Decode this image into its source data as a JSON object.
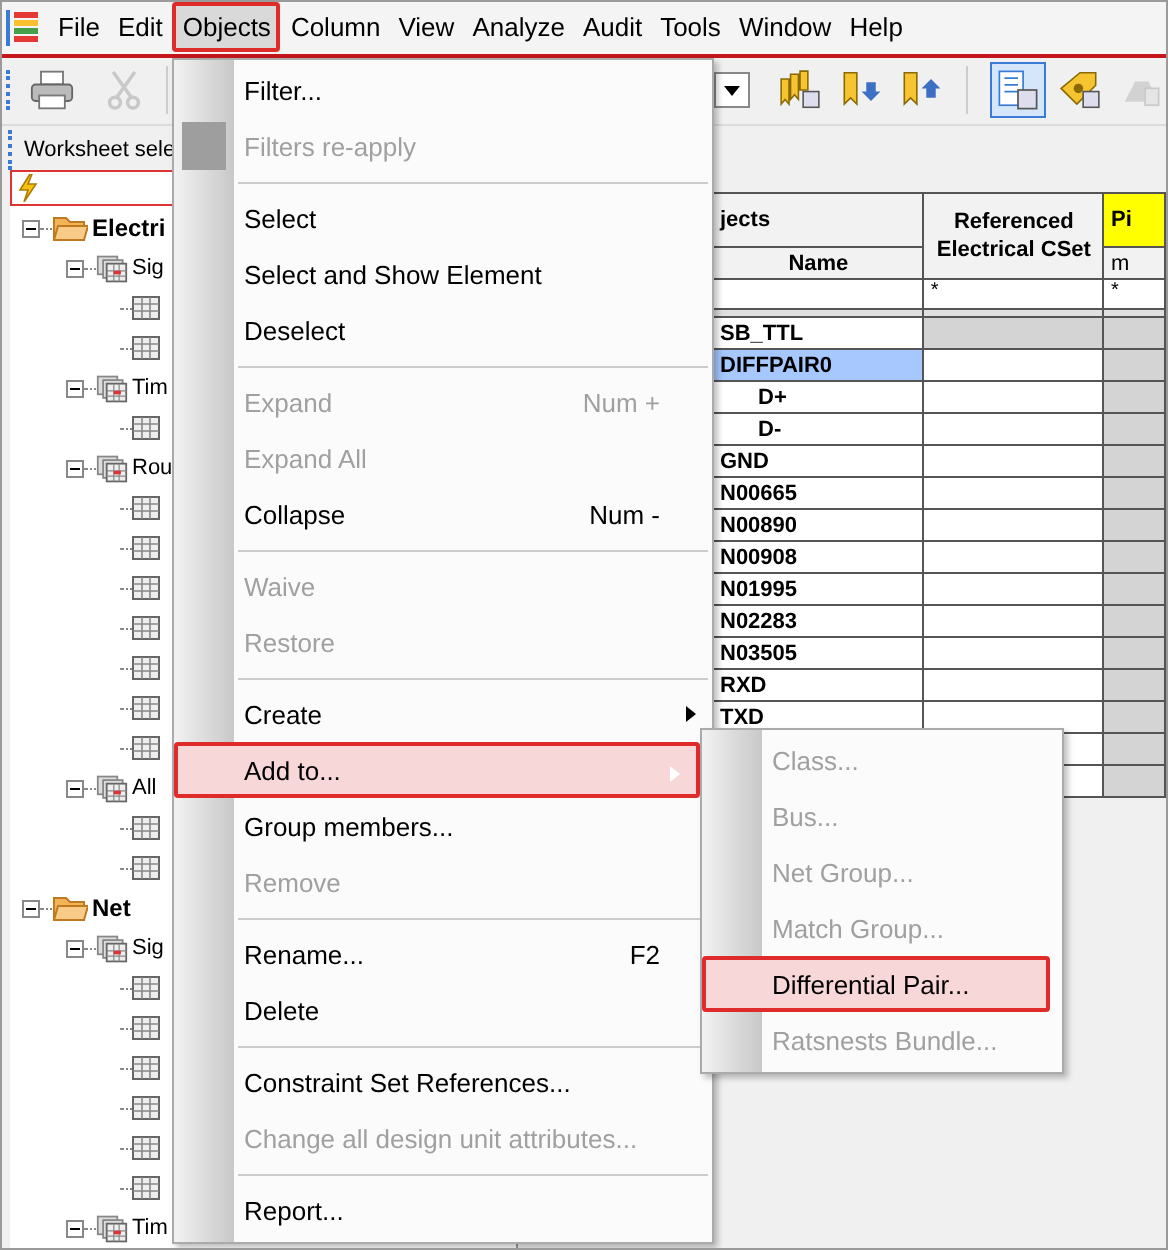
{
  "menubar": {
    "items": [
      {
        "label": "File",
        "selected": false
      },
      {
        "label": "Edit",
        "selected": false
      },
      {
        "label": "Objects",
        "selected": true
      },
      {
        "label": "Column",
        "selected": false
      },
      {
        "label": "View",
        "selected": false
      },
      {
        "label": "Analyze",
        "selected": false
      },
      {
        "label": "Audit",
        "selected": false
      },
      {
        "label": "Tools",
        "selected": false
      },
      {
        "label": "Window",
        "selected": false
      },
      {
        "label": "Help",
        "selected": false
      }
    ]
  },
  "toolbar": {
    "buttons": [
      {
        "kind": "printer",
        "disabled": false,
        "selected": false
      },
      {
        "kind": "scissors",
        "disabled": true,
        "selected": false
      },
      {
        "kind": "combo",
        "disabled": false,
        "selected": false
      },
      {
        "kind": "tags",
        "disabled": false,
        "selected": false
      },
      {
        "kind": "tag-down",
        "disabled": false,
        "selected": false
      },
      {
        "kind": "tag-up",
        "disabled": false,
        "selected": false
      },
      {
        "kind": "sheet",
        "disabled": false,
        "selected": true
      },
      {
        "kind": "tag-gear",
        "disabled": false,
        "selected": false
      },
      {
        "kind": "cloud",
        "disabled": true,
        "selected": false
      }
    ]
  },
  "worksheet_selector": {
    "title": "Worksheet sele"
  },
  "tree": [
    {
      "kind": "folder",
      "label": "Electri",
      "expanded": true,
      "children": [
        {
          "kind": "group",
          "label": "Sig",
          "expanded": true,
          "children": [
            {
              "kind": "table"
            },
            {
              "kind": "table"
            }
          ]
        },
        {
          "kind": "group",
          "label": "Tim",
          "expanded": true,
          "children": [
            {
              "kind": "table"
            }
          ]
        },
        {
          "kind": "group",
          "label": "Rou",
          "expanded": true,
          "children": [
            {
              "kind": "table"
            },
            {
              "kind": "table"
            },
            {
              "kind": "table"
            },
            {
              "kind": "table"
            },
            {
              "kind": "table"
            },
            {
              "kind": "table"
            },
            {
              "kind": "table"
            }
          ]
        },
        {
          "kind": "group",
          "label": "All",
          "expanded": true,
          "children": [
            {
              "kind": "table"
            },
            {
              "kind": "table"
            }
          ]
        }
      ]
    },
    {
      "kind": "folder",
      "label": "Net",
      "expanded": true,
      "children": [
        {
          "kind": "group",
          "label": "Sig",
          "expanded": true,
          "children": [
            {
              "kind": "table"
            },
            {
              "kind": "table"
            },
            {
              "kind": "table"
            },
            {
              "kind": "table"
            },
            {
              "kind": "table"
            },
            {
              "kind": "table"
            }
          ]
        },
        {
          "kind": "group",
          "label": "Tim",
          "expanded": true
        }
      ]
    }
  ],
  "table": {
    "group_header": "jects",
    "columns": [
      {
        "label": "Name"
      },
      {
        "label": "Referenced Electrical CSet",
        "filter": "*"
      },
      {
        "label": "Pi",
        "sub": "m",
        "filter": "*"
      }
    ],
    "rows": [
      {
        "name": "SB_TTL",
        "kind": "class",
        "selected": false
      },
      {
        "name": "DIFFPAIR0",
        "kind": "pair",
        "selected": true,
        "children": [
          {
            "name": "D+",
            "selected": false
          },
          {
            "name": "D-",
            "selected": false
          }
        ]
      },
      {
        "name": "GND",
        "kind": "net",
        "selected": false
      },
      {
        "name": "N00665",
        "kind": "net",
        "selected": false
      },
      {
        "name": "N00890",
        "kind": "net",
        "selected": false
      },
      {
        "name": "N00908",
        "kind": "net",
        "selected": false
      },
      {
        "name": "N01995",
        "kind": "net",
        "selected": false
      },
      {
        "name": "N02283",
        "kind": "net",
        "selected": false
      },
      {
        "name": "N03505",
        "kind": "net",
        "selected": false
      },
      {
        "name": "RXD",
        "kind": "net",
        "selected": false
      },
      {
        "name": "TXD",
        "kind": "net",
        "selected": false
      }
    ]
  },
  "objects_menu": {
    "items": [
      {
        "kind": "item",
        "label": "Filter...",
        "disabled": false,
        "selected": false
      },
      {
        "kind": "icon-item",
        "label": "Filters re-apply",
        "disabled": true,
        "selected": false
      },
      {
        "kind": "separator"
      },
      {
        "kind": "item",
        "label": "Select",
        "disabled": false,
        "selected": false
      },
      {
        "kind": "item",
        "label": "Select and Show Element",
        "disabled": false,
        "selected": false
      },
      {
        "kind": "item",
        "label": "Deselect",
        "disabled": false,
        "selected": false
      },
      {
        "kind": "separator"
      },
      {
        "kind": "item",
        "label": "Expand",
        "shortcut": "Num +",
        "disabled": true,
        "selected": false
      },
      {
        "kind": "item",
        "label": "Expand All",
        "disabled": true,
        "selected": false
      },
      {
        "kind": "item",
        "label": "Collapse",
        "shortcut": "Num -",
        "disabled": false,
        "selected": false
      },
      {
        "kind": "separator"
      },
      {
        "kind": "item",
        "label": "Waive",
        "disabled": true,
        "selected": false
      },
      {
        "kind": "item",
        "label": "Restore",
        "disabled": true,
        "selected": false
      },
      {
        "kind": "separator"
      },
      {
        "kind": "submenu",
        "label": "Create",
        "disabled": false,
        "selected": false
      },
      {
        "kind": "submenu",
        "label": "Add to...",
        "disabled": false,
        "selected": true
      },
      {
        "kind": "item",
        "label": "Group members...",
        "disabled": false,
        "selected": false
      },
      {
        "kind": "item",
        "label": "Remove",
        "disabled": true,
        "selected": false
      },
      {
        "kind": "separator"
      },
      {
        "kind": "item",
        "label": "Rename...",
        "shortcut": "F2",
        "disabled": false,
        "selected": false
      },
      {
        "kind": "item",
        "label": "Delete",
        "disabled": false,
        "selected": false
      },
      {
        "kind": "separator"
      },
      {
        "kind": "item",
        "label": "Constraint Set References...",
        "disabled": false,
        "selected": false
      },
      {
        "kind": "item",
        "label": "Change all design unit attributes...",
        "disabled": true,
        "selected": false
      },
      {
        "kind": "separator"
      },
      {
        "kind": "item",
        "label": "Report...",
        "disabled": false,
        "selected": false
      }
    ]
  },
  "add_to_submenu": {
    "items": [
      {
        "label": "Class...",
        "disabled": true,
        "selected": false
      },
      {
        "label": "Bus...",
        "disabled": true,
        "selected": false
      },
      {
        "label": "Net Group...",
        "disabled": true,
        "selected": false
      },
      {
        "label": "Match Group...",
        "disabled": true,
        "selected": false
      },
      {
        "label": "Differential Pair...",
        "disabled": false,
        "selected": true
      },
      {
        "label": "Ratsnests Bundle...",
        "disabled": true,
        "selected": false
      }
    ]
  }
}
